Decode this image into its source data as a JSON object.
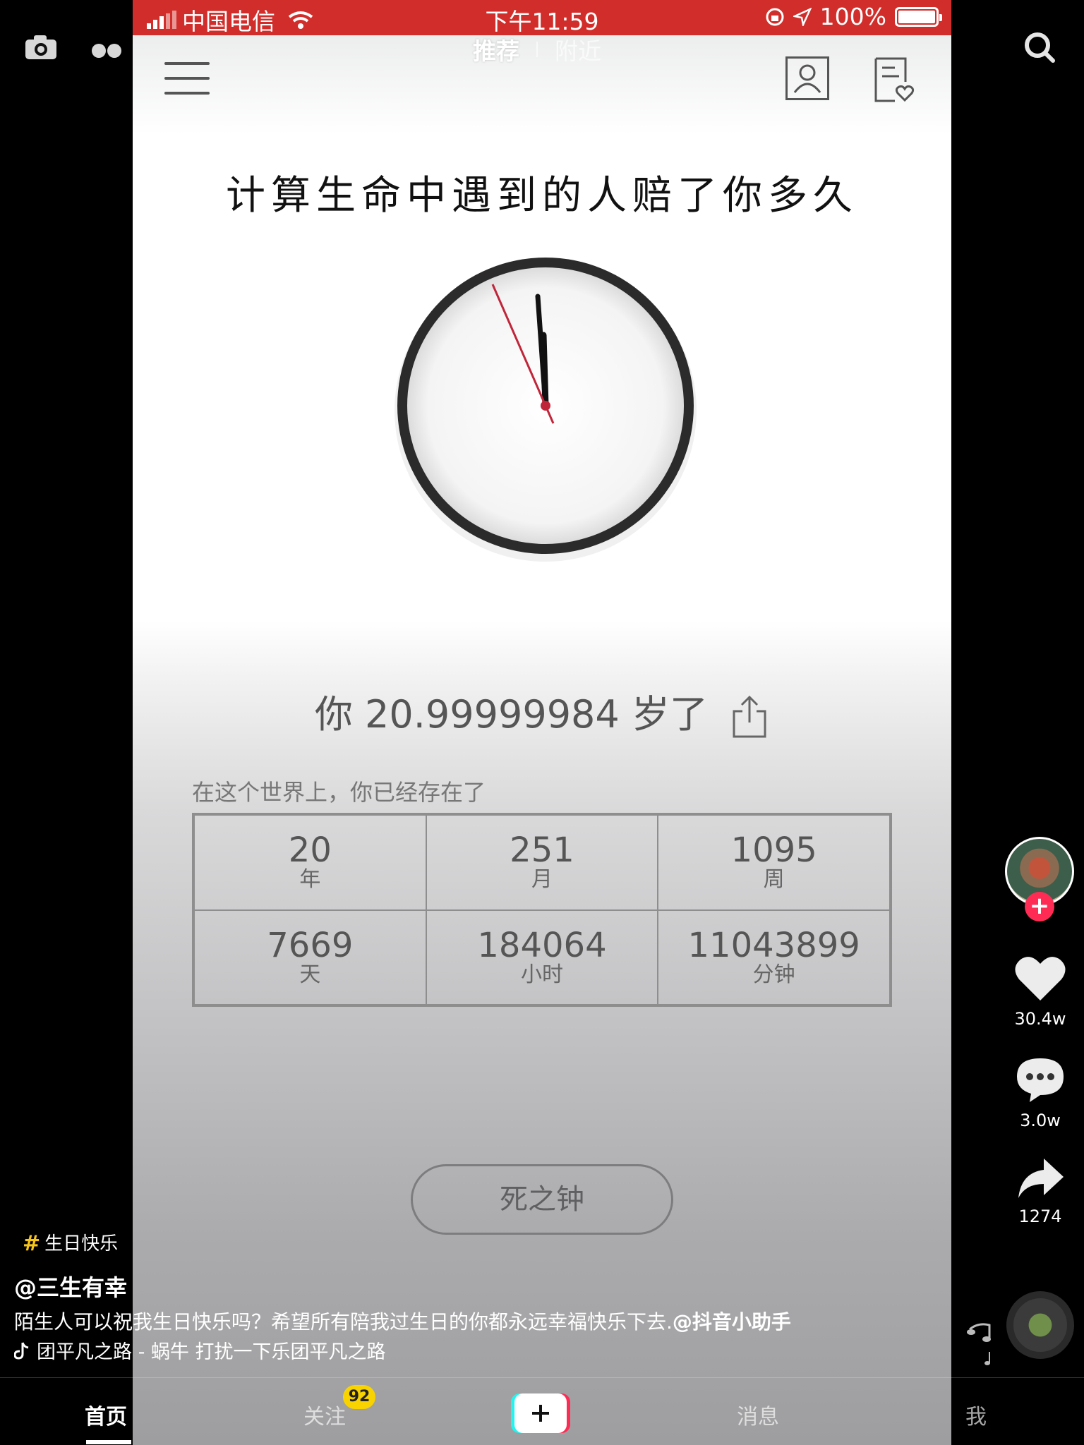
{
  "status_bar": {
    "carrier": "中国电信",
    "time": "下午11:59",
    "battery": "100%"
  },
  "top_tabs": {
    "active": "推荐",
    "inactive": "附近"
  },
  "page": {
    "headline": "计算生命中遇到的人赔了你多久",
    "age_line": "你 20.99999984 岁了",
    "exist_label": "在这个世界上，你已经存在了",
    "stats": [
      {
        "value": "20",
        "unit": "年"
      },
      {
        "value": "251",
        "unit": "月"
      },
      {
        "value": "1095",
        "unit": "周"
      },
      {
        "value": "7669",
        "unit": "天"
      },
      {
        "value": "184064",
        "unit": "小时"
      },
      {
        "value": "11043899",
        "unit": "分钟"
      }
    ],
    "button_label": "死之钟"
  },
  "actions": {
    "likes": "30.4w",
    "comments": "3.0w",
    "shares": "1274"
  },
  "caption": {
    "hashtag": "生日快乐",
    "author": "@三生有幸",
    "text": "陌生人可以祝我生日快乐吗？希望所有陪我过生日的你都永远幸福快乐下去.",
    "mention": "@抖音小助手",
    "music": "团平凡之路 - 蜗牛     打扰一下乐团平凡之路"
  },
  "bottom_nav": {
    "home": "首页",
    "follow": "关注",
    "follow_badge": "92",
    "messages": "消息",
    "me": "我"
  },
  "colors": {
    "status_red": "#d12e2b",
    "like_red": "#fe2c55",
    "badge_yellow": "#f8d300",
    "second_hand": "#c0263a"
  },
  "icons": [
    "camera-icon",
    "dots-icon",
    "search-icon",
    "menu-icon",
    "profile-icon",
    "favorite-list-icon",
    "share-icon",
    "heart-icon",
    "comment-icon",
    "share-arrow-icon",
    "music-note-icon",
    "plus-icon",
    "wifi-icon",
    "lock-rotation-icon",
    "location-icon",
    "battery-icon"
  ]
}
